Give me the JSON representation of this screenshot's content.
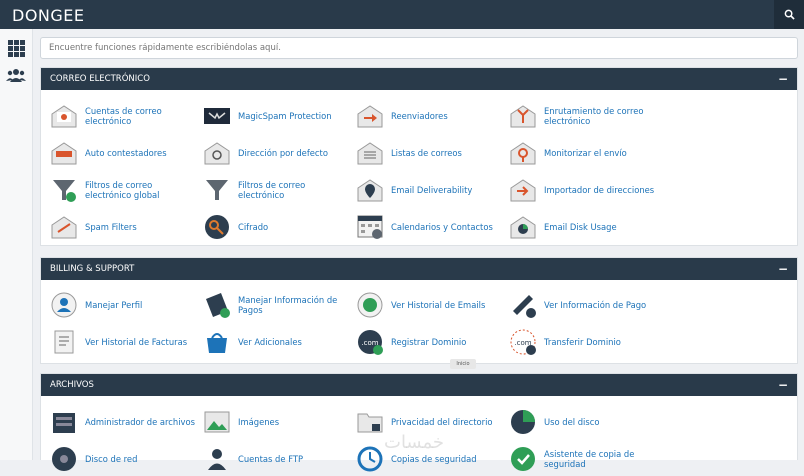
{
  "app": {
    "logo": "DONGEE"
  },
  "quick_search": {
    "placeholder": "Encuentre funciones rápidamente escribiéndolas aquí."
  },
  "tooltip": "Inicio",
  "watermark": "خمسات",
  "sections": [
    {
      "title": "CORREO ELECTRÓNICO",
      "collapse": "−",
      "items": [
        {
          "label": "Cuentas de correo electrónico",
          "icon": "email-accounts-icon"
        },
        {
          "label": "MagicSpam Protection",
          "icon": "magicspam-icon"
        },
        {
          "label": "Reenviadores",
          "icon": "forwarders-icon"
        },
        {
          "label": "Enrutamiento de correo electrónico",
          "icon": "email-routing-icon"
        },
        {
          "label": "Auto contestadores",
          "icon": "autoresponders-icon"
        },
        {
          "label": "Dirección por defecto",
          "icon": "default-address-icon"
        },
        {
          "label": "Listas de correos",
          "icon": "mailing-lists-icon"
        },
        {
          "label": "Monitorizar el envío",
          "icon": "track-delivery-icon"
        },
        {
          "label": "Filtros de correo electrónico global",
          "icon": "global-filters-icon"
        },
        {
          "label": "Filtros de correo electrónico",
          "icon": "email-filters-icon"
        },
        {
          "label": "Email Deliverability",
          "icon": "deliverability-icon"
        },
        {
          "label": "Importador de direcciones",
          "icon": "address-importer-icon"
        },
        {
          "label": "Spam Filters",
          "icon": "spam-filters-icon"
        },
        {
          "label": "Cifrado",
          "icon": "encryption-icon"
        },
        {
          "label": "Calendarios y Contactos",
          "icon": "calendars-icon"
        },
        {
          "label": "Email Disk Usage",
          "icon": "email-disk-usage-icon"
        }
      ]
    },
    {
      "title": "BILLING & SUPPORT",
      "collapse": "−",
      "items": [
        {
          "label": "Manejar Perfil",
          "icon": "manage-profile-icon"
        },
        {
          "label": "Manejar Información de Pagos",
          "icon": "manage-billing-icon"
        },
        {
          "label": "Ver Historial de Emails",
          "icon": "email-history-icon"
        },
        {
          "label": "Ver Información de Pago",
          "icon": "view-billing-icon"
        },
        {
          "label": "Ver Historial de Facturas",
          "icon": "invoice-history-icon"
        },
        {
          "label": "Ver Adicionales",
          "icon": "addons-icon"
        },
        {
          "label": "Registrar Dominio",
          "icon": "register-domain-icon"
        },
        {
          "label": "Transferir Dominio",
          "icon": "transfer-domain-icon"
        }
      ]
    },
    {
      "title": "ARCHIVOS",
      "collapse": "−",
      "items": [
        {
          "label": "Administrador de archivos",
          "icon": "file-manager-icon"
        },
        {
          "label": "Imágenes",
          "icon": "images-icon"
        },
        {
          "label": "Privacidad del directorio",
          "icon": "directory-privacy-icon"
        },
        {
          "label": "Uso del disco",
          "icon": "disk-usage-icon"
        },
        {
          "label": "Disco de red",
          "icon": "web-disk-icon"
        },
        {
          "label": "Cuentas de FTP",
          "icon": "ftp-accounts-icon"
        },
        {
          "label": "Copias de seguridad",
          "icon": "backup-icon"
        },
        {
          "label": "Asistente de copia de seguridad",
          "icon": "backup-wizard-icon"
        }
      ]
    }
  ]
}
